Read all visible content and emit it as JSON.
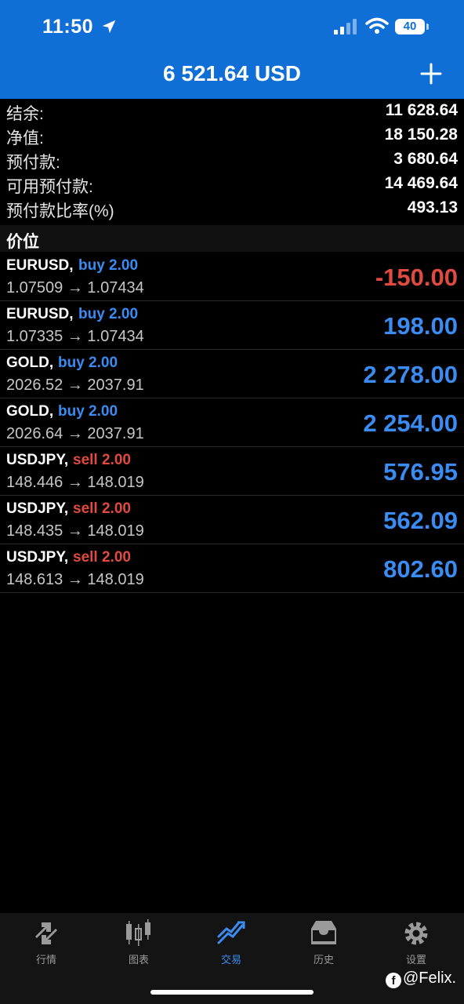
{
  "status_bar": {
    "time": "11:50",
    "battery": "40"
  },
  "header": {
    "title": "6 521.64 USD"
  },
  "summary": [
    {
      "label": "结余:",
      "value": "11 628.64"
    },
    {
      "label": "净值:",
      "value": "18 150.28"
    },
    {
      "label": "预付款:",
      "value": "3 680.64"
    },
    {
      "label": "可用预付款:",
      "value": "14 469.64"
    },
    {
      "label": "预付款比率(%)",
      "value": "493.13"
    }
  ],
  "section_title": "价位",
  "positions": [
    {
      "symbol": "EURUSD,",
      "action": "buy 2.00",
      "type": "buy",
      "prices": "1.07509 → 1.07434",
      "profit": "-150.00",
      "sign": "neg"
    },
    {
      "symbol": "EURUSD,",
      "action": "buy 2.00",
      "type": "buy",
      "prices": "1.07335 → 1.07434",
      "profit": "198.00",
      "sign": "pos"
    },
    {
      "symbol": "GOLD,",
      "action": "buy 2.00",
      "type": "buy",
      "prices": "2026.52 → 2037.91",
      "profit": "2 278.00",
      "sign": "pos"
    },
    {
      "symbol": "GOLD,",
      "action": "buy 2.00",
      "type": "buy",
      "prices": "2026.64 → 2037.91",
      "profit": "2 254.00",
      "sign": "pos"
    },
    {
      "symbol": "USDJPY,",
      "action": "sell 2.00",
      "type": "sell",
      "prices": "148.446 → 148.019",
      "profit": "576.95",
      "sign": "pos"
    },
    {
      "symbol": "USDJPY,",
      "action": "sell 2.00",
      "type": "sell",
      "prices": "148.435 → 148.019",
      "profit": "562.09",
      "sign": "pos"
    },
    {
      "symbol": "USDJPY,",
      "action": "sell 2.00",
      "type": "sell",
      "prices": "148.613 → 148.019",
      "profit": "802.60",
      "sign": "pos"
    }
  ],
  "tabs": [
    {
      "label": "行情",
      "icon": "quotes-icon",
      "active": false
    },
    {
      "label": "图表",
      "icon": "chart-icon",
      "active": false
    },
    {
      "label": "交易",
      "icon": "trade-icon",
      "active": true
    },
    {
      "label": "历史",
      "icon": "history-icon",
      "active": false
    },
    {
      "label": "设置",
      "icon": "settings-icon",
      "active": false
    }
  ],
  "watermark": "@Felix.",
  "colors": {
    "header_bg": "#0f6fd6",
    "buy": "#3b8cf2",
    "sell": "#e24a3f",
    "active_tab": "#3b8cf2"
  }
}
